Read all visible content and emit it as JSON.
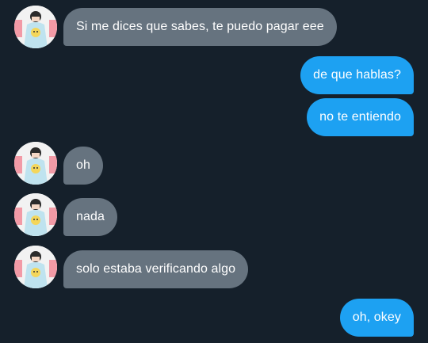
{
  "chat": {
    "bg_color": "#15202b",
    "incoming_color": "#66737f",
    "outgoing_color": "#1da1f2",
    "messages": [
      {
        "from": "them",
        "text": "Si me dices que sabes, te puedo pagar eee",
        "avatar": "profile-avatar"
      },
      {
        "from": "me",
        "text": "de que hablas?"
      },
      {
        "from": "me",
        "text": "no te entiendo"
      },
      {
        "from": "them",
        "text": "oh",
        "avatar": "profile-avatar"
      },
      {
        "from": "them",
        "text": "nada",
        "avatar": "profile-avatar"
      },
      {
        "from": "them",
        "text": "solo estaba verificando algo",
        "avatar": "profile-avatar"
      },
      {
        "from": "me",
        "text": "oh, okey"
      }
    ]
  }
}
